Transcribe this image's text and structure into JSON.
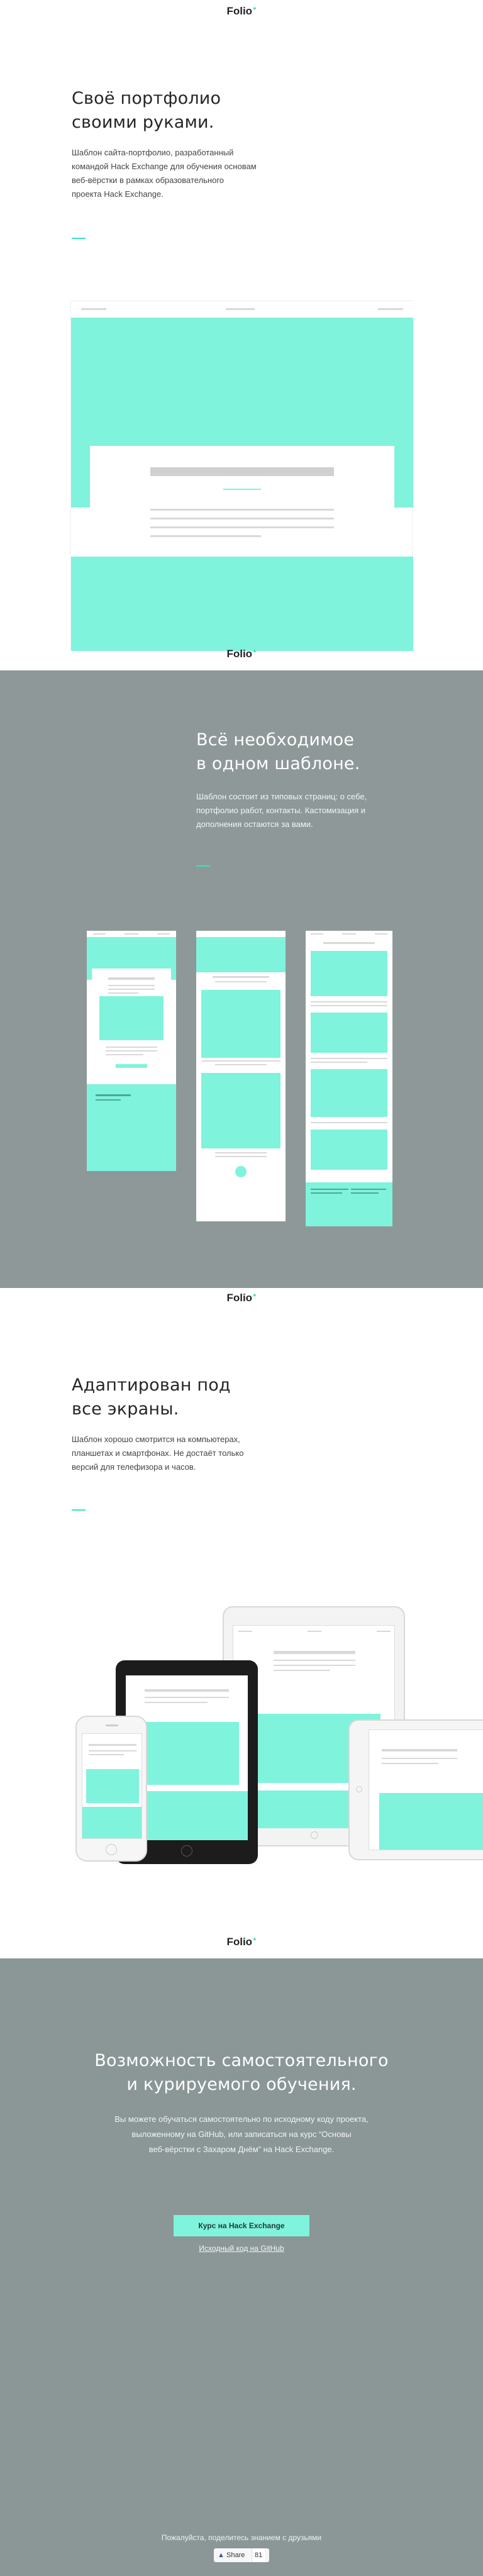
{
  "brand": {
    "logo": "Folio",
    "accent": "#7ff3dc",
    "dark_bg": "#8e9898",
    "darker_bg": "#8b9696"
  },
  "hero": {
    "title_line1": "Своё портфолио",
    "title_line2": "своими руками.",
    "text_line1": "Шаблон сайта-портфолио, разработанный",
    "text_line2": "командой Hack Exchange для обучения основам",
    "text_line3": "веб-вёрстки в рамках образовательного",
    "text_line4": "проекта Hack Exchange."
  },
  "template": {
    "title_line1": "Всё необходимое",
    "title_line2": "в одном шаблоне.",
    "text_line1": "Шаблон состоит из типовых страниц: о себе,",
    "text_line2": "портфолио работ, контакты. Кастомизация и",
    "text_line3": "дополнения остаются за вами."
  },
  "adaptive": {
    "title_line1": "Адаптирован под",
    "title_line2": "все экраны.",
    "text_line1": "Шаблон хорошо смотрится на компьютерах,",
    "text_line2": "планшетах и смартфонах. Не достаёт только",
    "text_line3": "версий для телефизора и часов."
  },
  "learning": {
    "title_line1": "Возможность самостоятельного",
    "title_line2": "и курируемого обучения.",
    "text_line1": "Вы можете обучаться самостоятельно по исходному коду проекта,",
    "text_line2": "выложенному на GitHub, или записаться на курс “Основы",
    "text_line3": "веб-вёрстки с Захаром Днём” на Hack Exchange.",
    "course_button": "Курс на Hack Exchange",
    "github_link": "Исходный код на GitHub"
  },
  "footer": {
    "share_prompt": "Пожалуйста, поделитесь знанием с друзьями",
    "share_button": "Share",
    "share_count": "81"
  }
}
